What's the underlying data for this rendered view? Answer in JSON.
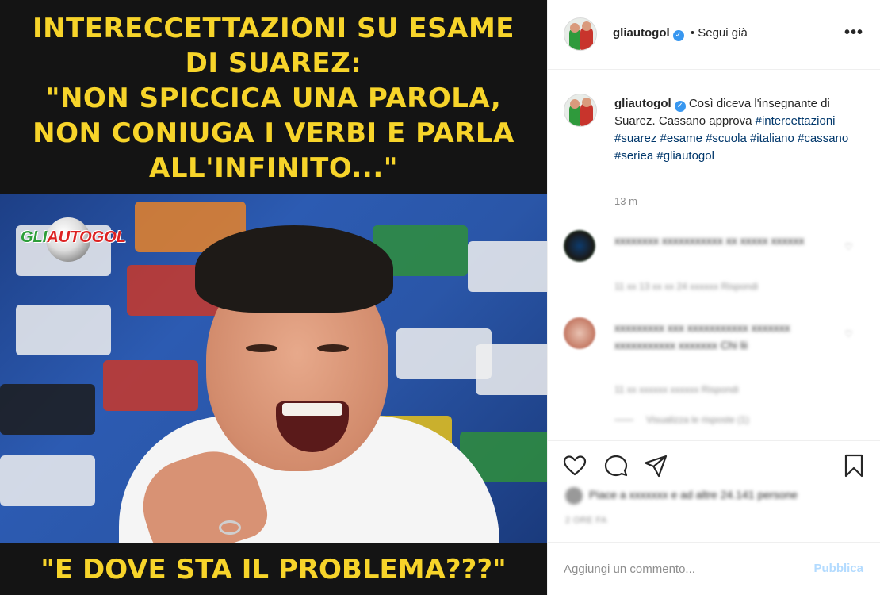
{
  "post": {
    "top_caption": "INTERECCETTAZIONI SU ESAME\nDI SUAREZ:\n\"NON SPICCICA UNA PAROLA,\nNON CONIUGA I VERBI E PARLA\nALL'INFINITO...\"",
    "watermark_prefix": "GLI",
    "watermark_brand": "AUTOGOL",
    "bottom_caption": "\"E DOVE STA IL PROBLEMA???\""
  },
  "header": {
    "username": "gliautogol",
    "follow_label": "• Segui già",
    "more_label": "•••"
  },
  "caption": {
    "username": "gliautogol",
    "text": "Così diceva l'insegnante di Suarez. Cassano approva",
    "hashtags": [
      "#intercettazioni",
      "#suarez",
      "#esame",
      "#scuola",
      "#italiano",
      "#cassano",
      "#seriea",
      "#gliautogol"
    ],
    "time": "13 m"
  },
  "comments": [
    {
      "text": "xxxxxxxx xxxxxxxxxxx xx xxxxx xxxxxx",
      "meta": "11 xx  13 xx xx  24 xxxxxx  Rispondi"
    },
    {
      "text": "xxxxxxxxx xxx xxxxxxxxxxx xxxxxxx xxxxxxxxxxx xxxxxxx Chi lii",
      "meta": "11 xx  xxxxxx xxxxxx  Rispondi"
    }
  ],
  "view_replies": "Visualizza le risposte (1)",
  "likes_text": "Piace a xxxxxxx e ad altre 24.141 persone",
  "post_time": "2 ORE FA",
  "add_comment": {
    "placeholder": "Aggiungi un commento...",
    "publish_label": "Pubblica"
  },
  "colors": {
    "caption_yellow": "#f7d42a",
    "verified_blue": "#3897f0",
    "hashtag_blue": "#00376b",
    "publish_disabled": "#b3dbff"
  }
}
